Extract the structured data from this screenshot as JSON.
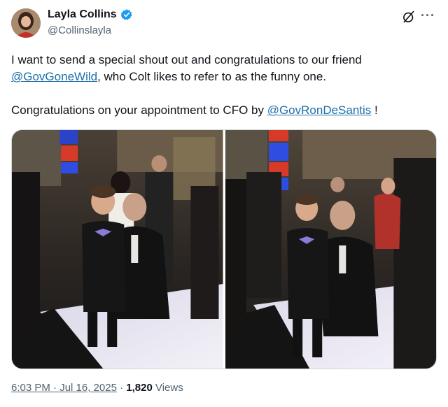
{
  "author": {
    "name": "Layla Collins",
    "handle": "@Collinslayla"
  },
  "tweet": {
    "line1_pre": "I want to send a special shout out and congratulations to our friend ",
    "mention1": "@GovGoneWild",
    "line1_post": ", who Colt likes to refer to as the funny one.",
    "line2_pre": "Congratulations on your appointment to CFO by ",
    "mention2": "@GovRonDeSantis",
    "line2_post": " !"
  },
  "meta": {
    "time": "6:03 PM · Jul 16, 2025",
    "separator": " · ",
    "views_count": "1,820",
    "views_label": " Views"
  },
  "icons": {
    "verified": "verified-badge-icon",
    "grok": "grok-icon",
    "more": "more-icon"
  },
  "colors": {
    "link": "#1d6fa8",
    "verified": "#1d9bf0",
    "muted": "#536471"
  }
}
